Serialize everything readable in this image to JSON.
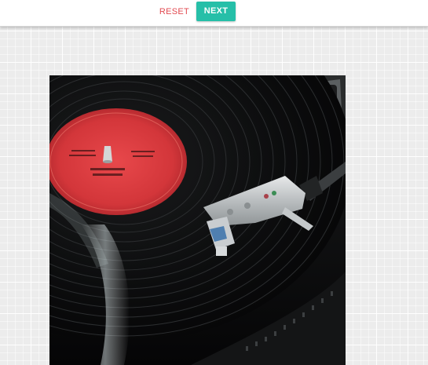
{
  "toolbar": {
    "reset_label": "RESET",
    "next_label": "NEXT"
  },
  "photo": {
    "subject": "turntable-record-photo"
  },
  "colors": {
    "accent": "#26bfa8",
    "reset_text": "#e24b52",
    "record_label": "#d9363b"
  }
}
